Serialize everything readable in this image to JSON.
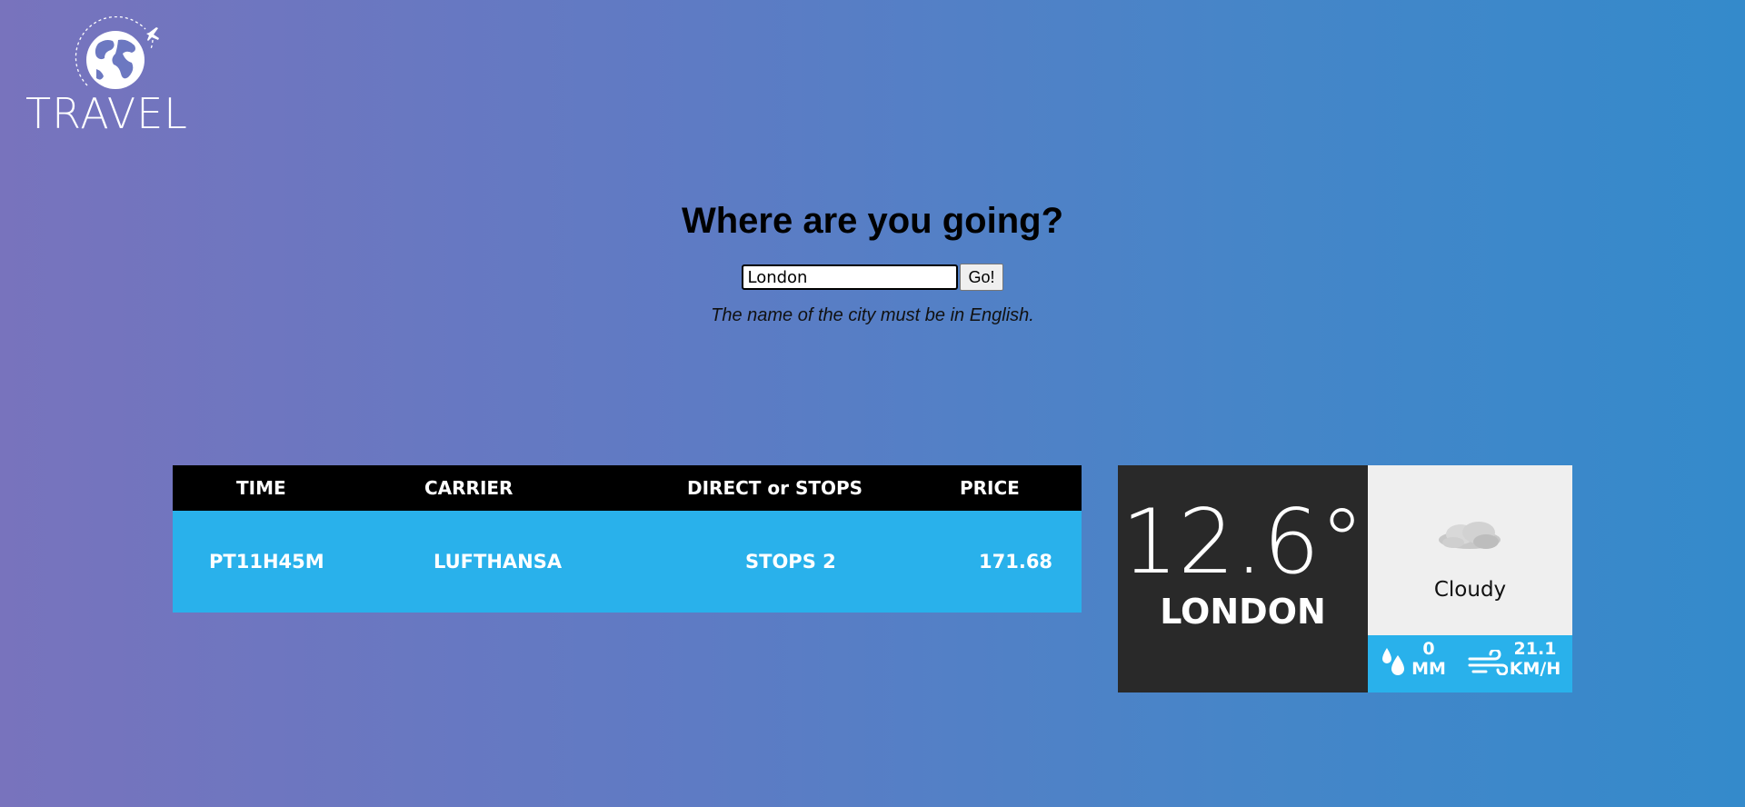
{
  "brand": {
    "name": "TRAVEL",
    "icon": "globe-plane-icon"
  },
  "search": {
    "heading": "Where are you going?",
    "input_value": "London",
    "button_label": "Go!",
    "hint": "The name of the city must be in English."
  },
  "flights": {
    "columns": [
      "TIME",
      "CARRIER",
      "DIRECT or STOPS",
      "PRICE"
    ],
    "rows": [
      {
        "time": "PT11H45M",
        "carrier": "LUFTHANSA",
        "stops": "STOPS 2",
        "price": "171.68"
      }
    ]
  },
  "weather": {
    "temperature": "12.6°",
    "city": "LONDON",
    "condition": "Cloudy",
    "condition_icon": "cloud-icon",
    "precipitation": {
      "value": "0",
      "unit": "MM",
      "icon": "raindrops-icon"
    },
    "wind": {
      "value": "21.1",
      "unit": "KM/H",
      "icon": "wind-icon"
    }
  },
  "colors": {
    "table_header": "#000000",
    "table_row": "#29b1eb",
    "weather_dark": "#292929",
    "weather_light": "#efefef",
    "accent": "#29b1eb"
  }
}
